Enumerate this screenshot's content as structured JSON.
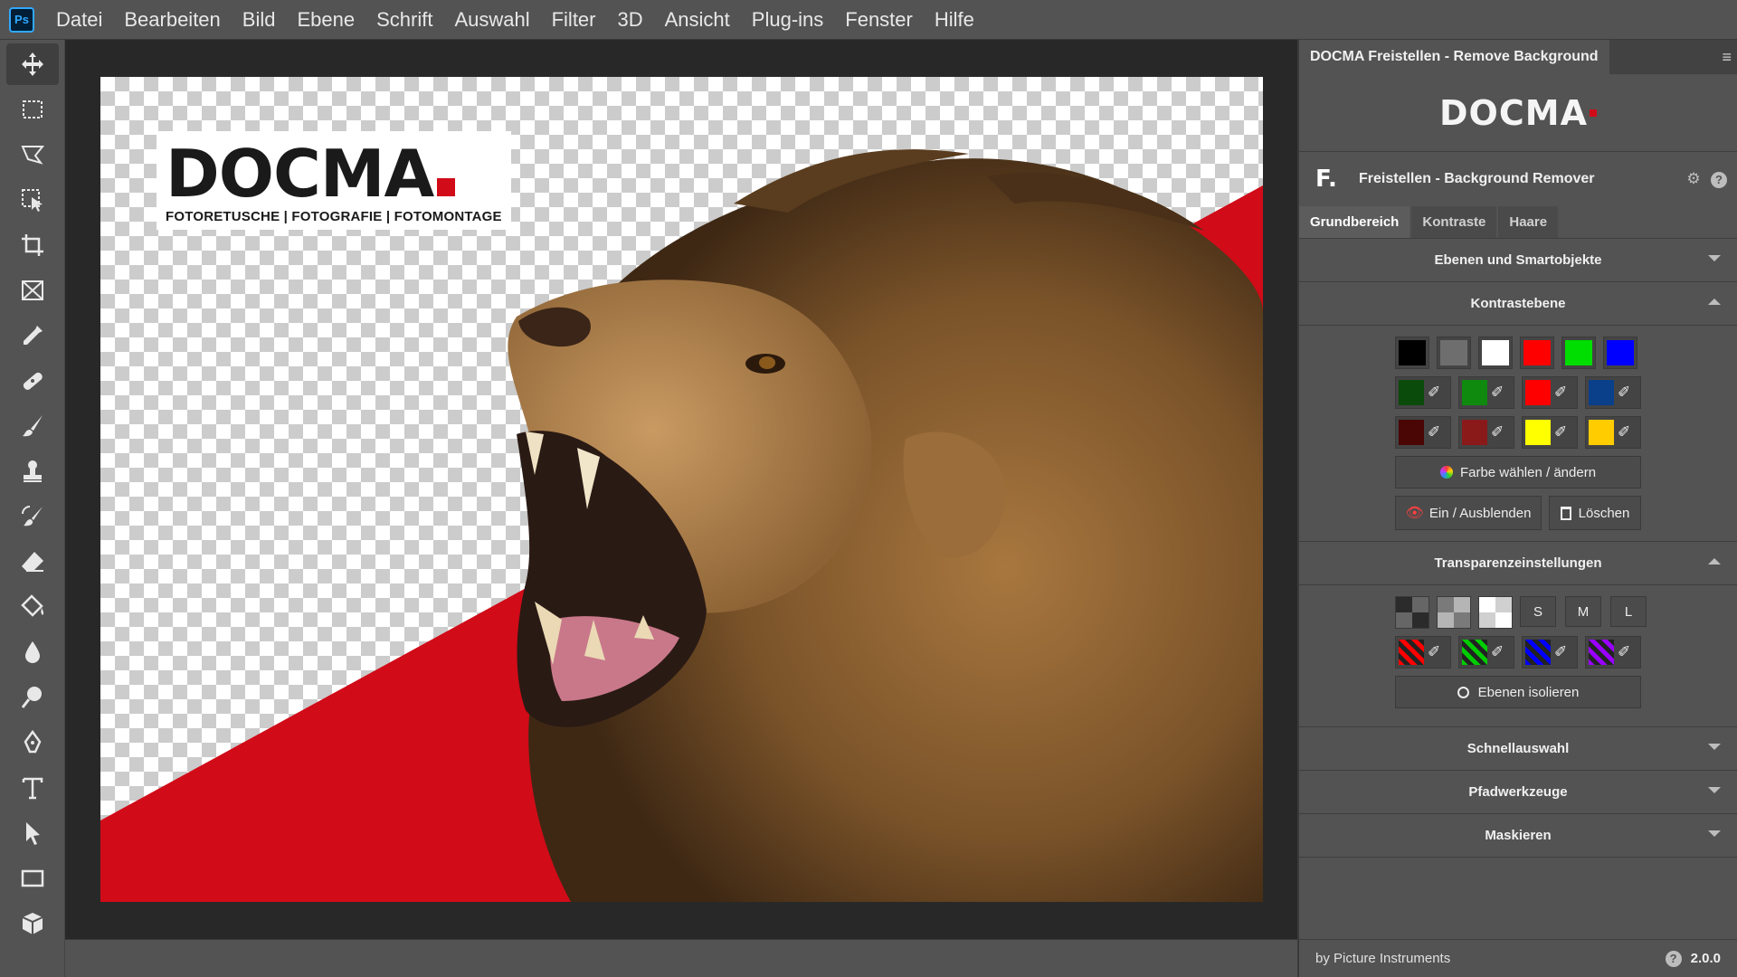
{
  "menubar": {
    "app_icon": "Ps",
    "items": [
      "Datei",
      "Bearbeiten",
      "Bild",
      "Ebene",
      "Schrift",
      "Auswahl",
      "Filter",
      "3D",
      "Ansicht",
      "Plug-ins",
      "Fenster",
      "Hilfe"
    ]
  },
  "tools": [
    "move-icon",
    "marquee-icon",
    "lasso-icon",
    "object-selection-icon",
    "crop-icon",
    "frame-icon",
    "eyedropper-icon",
    "healing-icon",
    "brush-icon",
    "stamp-icon",
    "history-brush-icon",
    "eraser-icon",
    "paint-bucket-icon",
    "blur-icon",
    "dodge-icon",
    "pen-icon",
    "type-icon",
    "path-selection-icon",
    "rectangle-icon",
    "3d-icon"
  ],
  "canvas": {
    "logo_word": "DOCMA",
    "logo_tagline": "FOTORETUSCHE | FOTOGRAFIE | FOTOMONTAGE",
    "accent_color": "#d10b18"
  },
  "panel": {
    "tab_title": "DOCMA Freistellen - Remove Background",
    "brand": "DOCMA",
    "plugin_initial": "F.",
    "plugin_title": "Freistellen - Background Remover",
    "subtabs": [
      "Grundbereich",
      "Kontraste",
      "Haare"
    ],
    "sections": {
      "ebenen": "Ebenen und Smartobjekte",
      "kontrast": "Kontrastebene",
      "transparenz": "Transparenzeinstellungen",
      "schnell": "Schnellauswahl",
      "pfad": "Pfadwerkzeuge",
      "maskieren": "Maskieren"
    },
    "contrast_colors_row1": [
      "#000000",
      "#6e6e6e",
      "#ffffff",
      "#ff0000",
      "#00dd00",
      "#0000ff"
    ],
    "contrast_picker_row2": [
      "#0a4a0a",
      "#0f8a0f",
      "#ff0000",
      "#0a3f8a"
    ],
    "contrast_picker_row3": [
      "#4a0505",
      "#8a1a1a",
      "#ffff00",
      "#ffcc00"
    ],
    "btn_farbe": "Farbe wählen / ändern",
    "btn_ein": "Ein / Ausblenden",
    "btn_loeschen": "Löschen",
    "size_buttons": [
      "S",
      "M",
      "L"
    ],
    "transparency_picker_colors": [
      "#ff0000",
      "#00cc00",
      "#0000ff",
      "#9900ff"
    ],
    "btn_isolieren": "Ebenen isolieren",
    "footer_by": "by Picture Instruments",
    "version": "2.0.0"
  }
}
